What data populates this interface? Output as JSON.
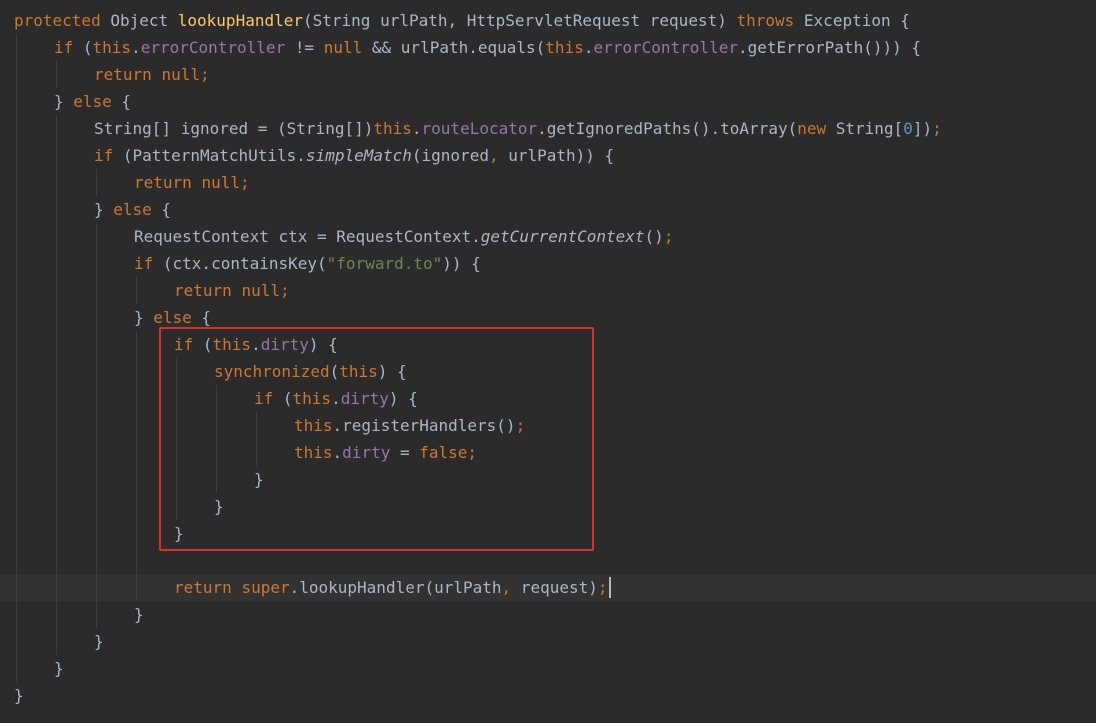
{
  "editor": {
    "language": "java",
    "theme": "darcula",
    "highlight_color": "#d9302c",
    "caret_after_line": 22,
    "highlighted_lines": [
      12,
      19
    ],
    "lines": [
      {
        "indent": 0,
        "tokens": [
          {
            "t": "protected",
            "c": "kw"
          },
          {
            "t": " Object "
          },
          {
            "t": "lookupHandler",
            "c": "fn"
          },
          {
            "t": "(String urlPath, HttpServletRequest request) "
          },
          {
            "t": "throws",
            "c": "kw"
          },
          {
            "t": " Exception {"
          }
        ]
      },
      {
        "indent": 1,
        "tokens": [
          {
            "t": "if",
            "c": "kw"
          },
          {
            "t": " ("
          },
          {
            "t": "this",
            "c": "kw"
          },
          {
            "t": "."
          },
          {
            "t": "errorController",
            "c": "field"
          },
          {
            "t": " != "
          },
          {
            "t": "null",
            "c": "kw"
          },
          {
            "t": " && urlPath.equals("
          },
          {
            "t": "this",
            "c": "kw"
          },
          {
            "t": "."
          },
          {
            "t": "errorController",
            "c": "field"
          },
          {
            "t": ".getErrorPath())) {"
          }
        ]
      },
      {
        "indent": 2,
        "tokens": [
          {
            "t": "return",
            "c": "kw"
          },
          {
            "t": " "
          },
          {
            "t": "null",
            "c": "kw"
          },
          {
            "t": ";",
            "c": "punc"
          }
        ]
      },
      {
        "indent": 1,
        "tokens": [
          {
            "t": "} "
          },
          {
            "t": "else",
            "c": "kw"
          },
          {
            "t": " {"
          }
        ]
      },
      {
        "indent": 2,
        "tokens": [
          {
            "t": "String[] ignored = (String[])"
          },
          {
            "t": "this",
            "c": "kw"
          },
          {
            "t": "."
          },
          {
            "t": "routeLocator",
            "c": "field"
          },
          {
            "t": ".getIgnoredPaths().toArray("
          },
          {
            "t": "new",
            "c": "kw"
          },
          {
            "t": " String["
          },
          {
            "t": "0",
            "c": "num"
          },
          {
            "t": "])"
          },
          {
            "t": ";",
            "c": "punc"
          }
        ]
      },
      {
        "indent": 2,
        "tokens": [
          {
            "t": "if",
            "c": "kw"
          },
          {
            "t": " (PatternMatchUtils."
          },
          {
            "t": "simpleMatch",
            "c": "it"
          },
          {
            "t": "(ignored"
          },
          {
            "t": ",",
            "c": "punc"
          },
          {
            "t": " urlPath)) {"
          }
        ]
      },
      {
        "indent": 3,
        "tokens": [
          {
            "t": "return",
            "c": "kw"
          },
          {
            "t": " "
          },
          {
            "t": "null",
            "c": "kw"
          },
          {
            "t": ";",
            "c": "punc"
          }
        ]
      },
      {
        "indent": 2,
        "tokens": [
          {
            "t": "} "
          },
          {
            "t": "else",
            "c": "kw"
          },
          {
            "t": " {"
          }
        ]
      },
      {
        "indent": 3,
        "tokens": [
          {
            "t": "RequestContext ctx = RequestContext."
          },
          {
            "t": "getCurrentContext",
            "c": "it"
          },
          {
            "t": "()"
          },
          {
            "t": ";",
            "c": "punc"
          }
        ]
      },
      {
        "indent": 3,
        "tokens": [
          {
            "t": "if",
            "c": "kw"
          },
          {
            "t": " (ctx.containsKey("
          },
          {
            "t": "\"forward.to\"",
            "c": "str"
          },
          {
            "t": ")) {"
          }
        ]
      },
      {
        "indent": 4,
        "tokens": [
          {
            "t": "return",
            "c": "kw"
          },
          {
            "t": " "
          },
          {
            "t": "null",
            "c": "kw"
          },
          {
            "t": ";",
            "c": "punc"
          }
        ]
      },
      {
        "indent": 3,
        "tokens": [
          {
            "t": "} "
          },
          {
            "t": "else",
            "c": "kw"
          },
          {
            "t": " {"
          }
        ]
      },
      {
        "indent": 4,
        "tokens": [
          {
            "t": "if",
            "c": "kw"
          },
          {
            "t": " ("
          },
          {
            "t": "this",
            "c": "kw"
          },
          {
            "t": "."
          },
          {
            "t": "dirty",
            "c": "field"
          },
          {
            "t": ") {"
          }
        ]
      },
      {
        "indent": 5,
        "tokens": [
          {
            "t": "synchronized",
            "c": "kw"
          },
          {
            "t": "("
          },
          {
            "t": "this",
            "c": "kw"
          },
          {
            "t": ") {"
          }
        ]
      },
      {
        "indent": 6,
        "tokens": [
          {
            "t": "if",
            "c": "kw"
          },
          {
            "t": " ("
          },
          {
            "t": "this",
            "c": "kw"
          },
          {
            "t": "."
          },
          {
            "t": "dirty",
            "c": "field"
          },
          {
            "t": ") {"
          }
        ]
      },
      {
        "indent": 7,
        "tokens": [
          {
            "t": "this",
            "c": "kw"
          },
          {
            "t": ".registerHandlers()"
          },
          {
            "t": ";",
            "c": "punc"
          }
        ]
      },
      {
        "indent": 7,
        "tokens": [
          {
            "t": "this",
            "c": "kw"
          },
          {
            "t": "."
          },
          {
            "t": "dirty",
            "c": "field"
          },
          {
            "t": " = "
          },
          {
            "t": "false",
            "c": "kw"
          },
          {
            "t": ";",
            "c": "punc"
          }
        ]
      },
      {
        "indent": 6,
        "tokens": [
          {
            "t": "}"
          }
        ]
      },
      {
        "indent": 5,
        "tokens": [
          {
            "t": "}"
          }
        ]
      },
      {
        "indent": 4,
        "tokens": [
          {
            "t": "}"
          }
        ]
      },
      {
        "indent": 4,
        "tokens": []
      },
      {
        "indent": 4,
        "tokens": [
          {
            "t": "return",
            "c": "kw"
          },
          {
            "t": " "
          },
          {
            "t": "super",
            "c": "kw"
          },
          {
            "t": ".lookupHandler(urlPath"
          },
          {
            "t": ",",
            "c": "punc"
          },
          {
            "t": " request)"
          },
          {
            "t": ";",
            "c": "punc"
          }
        ]
      },
      {
        "indent": 3,
        "tokens": [
          {
            "t": "}"
          }
        ]
      },
      {
        "indent": 2,
        "tokens": [
          {
            "t": "}"
          }
        ]
      },
      {
        "indent": 1,
        "tokens": [
          {
            "t": "}"
          }
        ]
      },
      {
        "indent": 0,
        "tokens": [
          {
            "t": "}"
          }
        ]
      }
    ]
  }
}
